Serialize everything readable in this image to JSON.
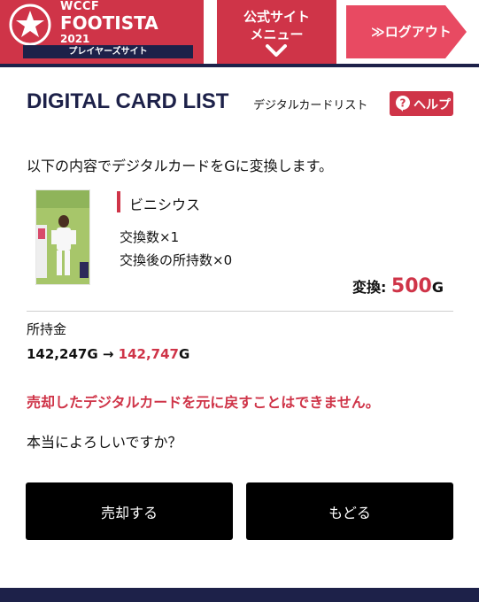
{
  "header": {
    "logo": {
      "wccf": "WCCF",
      "footista": "FOOTISTA",
      "year": "2021",
      "subtitle": "プレイヤーズサイト"
    },
    "menu": {
      "line1": "公式サイト",
      "line2": "メニュー"
    },
    "logout_label": "≫ログアウト"
  },
  "title": {
    "main": "DIGITAL CARD LIST",
    "sub": "デジタルカードリスト",
    "help_label": "ヘルプ"
  },
  "intro_text": "以下の内容でデジタルカードをGに変換します。",
  "card": {
    "name": "ビニシウス",
    "exchange_count": "交換数×1",
    "after_count": "交換後の所持数×0",
    "convert_label": "変換: ",
    "convert_value": "500",
    "convert_unit": "G"
  },
  "money": {
    "label": "所持金",
    "before": "142,247G",
    "arrow": " → ",
    "after_value": "142,747",
    "after_unit": "G"
  },
  "warning_text": "売却したデジタルカードを元に戻すことはできません。",
  "confirm_text": "本当によろしいですか？",
  "buttons": {
    "sell": "売却する",
    "back": "もどる"
  },
  "footer_text": "",
  "colors": {
    "accent": "#cf3448",
    "navy": "#1d2149"
  }
}
